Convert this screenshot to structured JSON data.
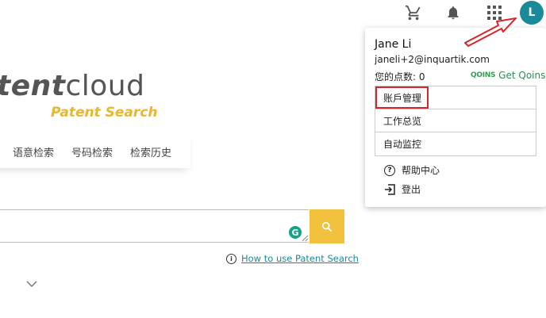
{
  "topbar": {
    "cart_icon": "cart-icon",
    "bell_icon": "bell-icon",
    "apps_icon": "apps-grid-icon",
    "avatar_initial": "L"
  },
  "logo": {
    "main_bold": "tent",
    "main_light": "cloud",
    "subtitle": "Patent Search"
  },
  "tabs": [
    "语意检索",
    "号码检索",
    "检索历史"
  ],
  "search": {
    "value": "",
    "placeholder": ""
  },
  "help_link": "How to use Patent Search",
  "user_menu": {
    "name": "Jane Li",
    "email": "janeli+2@inquartik.com",
    "points_label": "您的点数: 0",
    "qoins_brand": "QOINS",
    "qoins_link": "Get Qoins",
    "items": [
      "账戶管理",
      "工作总览",
      "自动监控"
    ],
    "help": "帮助中心",
    "logout": "登出"
  },
  "colors": {
    "accent": "#1a8a9a",
    "search_button": "#f2c13e",
    "logo_subtitle": "#e8b630",
    "annotation": "#d9232a"
  }
}
